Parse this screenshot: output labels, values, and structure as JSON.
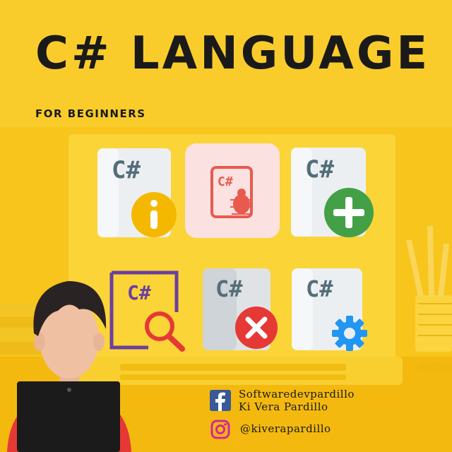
{
  "poster": {
    "title": "C# LANGUAGE",
    "subtitle": "FOR BEGINNERS"
  },
  "tiles": {
    "info": {
      "label": "C#",
      "badge_icon": "info-icon"
    },
    "debug": {
      "label": "C#",
      "badge_icon": "bug-icon"
    },
    "add": {
      "label": "C#",
      "badge_icon": "plus-icon"
    },
    "search": {
      "label": "C#",
      "badge_icon": "magnifier-icon"
    },
    "delete": {
      "label": "C#",
      "badge_icon": "close-icon"
    },
    "settings": {
      "label": "C#",
      "badge_icon": "gear-icon"
    }
  },
  "social": {
    "facebook_line1": "Softwaredevpardillo",
    "facebook_line2": "Ki Vera Pardillo",
    "instagram_handle": "@kiverapardillo"
  },
  "colors": {
    "background": "#f7c51c",
    "facebook": "#3b5998",
    "info_badge": "#f5b800",
    "bug": "#e85a4f",
    "plus_badge": "#43a047",
    "search": "#6a3fa0",
    "delete_badge": "#e53935",
    "gear": "#2196f3"
  }
}
